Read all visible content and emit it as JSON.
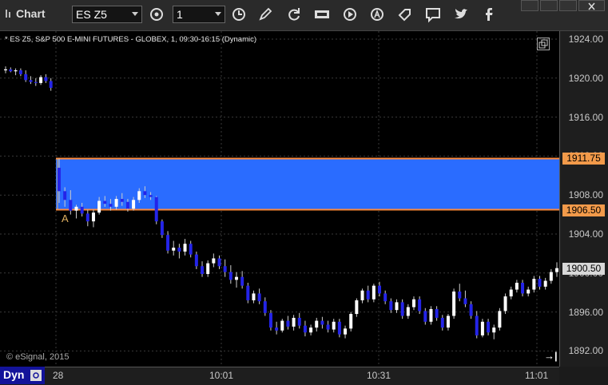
{
  "app": {
    "title": "Chart"
  },
  "toolbar": {
    "symbol": "ES Z5",
    "interval": "1",
    "buttons": [
      "settings-icon",
      "clock-icon",
      "pencil-icon",
      "refresh-icon",
      "get-icon",
      "play-icon",
      "alert-icon",
      "tag-icon",
      "comment-icon",
      "twitter-icon",
      "facebook-icon"
    ]
  },
  "chart": {
    "info_line": "* ES Z5, S&P 500 E-MINI FUTURES - GLOBEX, 1, 09:30-16:15 (Dynamic)",
    "copyright": "© eSignal, 2015",
    "annotation_label": "A",
    "price_ticks": [
      "1924.00",
      "1920.00",
      "1916.00",
      "1912.00",
      "1908.00",
      "1904.00",
      "1900.00",
      "1896.00",
      "1892.00"
    ],
    "price_tags": {
      "upper": "1911.75",
      "lower": "1906.50",
      "last": "1900.50"
    },
    "zone_color": "#2a6cff",
    "line_color": "#ff8a3a",
    "time_labels": [
      "28",
      "10:01",
      "10:31",
      "11:01"
    ],
    "mode_label": "Dyn"
  },
  "chart_data": {
    "type": "candlestick",
    "ylim": [
      1891.5,
      1925.5
    ],
    "zone": {
      "top": 1911.75,
      "bottom": 1906.5
    },
    "last": 1900.5,
    "candles": [
      [
        1920.8,
        1921.2,
        1920.5,
        1920.9
      ],
      [
        1920.9,
        1921.1,
        1920.6,
        1920.7
      ],
      [
        1920.7,
        1921.0,
        1920.3,
        1920.8
      ],
      [
        1920.8,
        1921.0,
        1920.2,
        1920.4
      ],
      [
        1920.4,
        1920.8,
        1919.6,
        1919.8
      ],
      [
        1919.8,
        1920.2,
        1919.4,
        1919.6
      ],
      [
        1919.6,
        1920.0,
        1919.2,
        1919.5
      ],
      [
        1919.5,
        1920.3,
        1919.3,
        1920.1
      ],
      [
        1920.1,
        1920.4,
        1919.5,
        1919.7
      ],
      [
        1919.7,
        1920.0,
        1918.7,
        1919.0
      ],
      [
        1910.8,
        1911.75,
        1907.2,
        1908.4
      ],
      [
        1908.4,
        1908.8,
        1906.8,
        1907.5
      ],
      [
        1907.5,
        1908.5,
        1906.0,
        1906.4
      ],
      [
        1906.4,
        1907.0,
        1905.6,
        1906.8
      ],
      [
        1906.8,
        1907.2,
        1905.8,
        1906.1
      ],
      [
        1906.1,
        1906.5,
        1904.8,
        1905.3
      ],
      [
        1905.3,
        1906.5,
        1904.7,
        1906.2
      ],
      [
        1906.2,
        1907.8,
        1906.0,
        1907.4
      ],
      [
        1907.4,
        1907.9,
        1906.8,
        1907.1
      ],
      [
        1907.1,
        1907.6,
        1906.4,
        1906.8
      ],
      [
        1906.8,
        1907.9,
        1906.5,
        1907.6
      ],
      [
        1907.6,
        1908.2,
        1906.9,
        1907.3
      ],
      [
        1907.3,
        1907.6,
        1906.3,
        1906.6
      ],
      [
        1906.6,
        1907.8,
        1906.4,
        1907.5
      ],
      [
        1907.5,
        1908.7,
        1907.2,
        1908.4
      ],
      [
        1908.4,
        1908.9,
        1907.7,
        1908.0
      ],
      [
        1908.0,
        1908.3,
        1907.5,
        1907.8
      ],
      [
        1907.8,
        1907.9,
        1905.0,
        1905.3
      ],
      [
        1905.3,
        1905.5,
        1903.6,
        1903.9
      ],
      [
        1903.9,
        1904.3,
        1902.0,
        1902.3
      ],
      [
        1902.3,
        1903.3,
        1901.8,
        1902.6
      ],
      [
        1902.6,
        1903.0,
        1901.5,
        1902.2
      ],
      [
        1902.2,
        1903.5,
        1901.8,
        1903.0
      ],
      [
        1903.0,
        1903.3,
        1901.6,
        1901.9
      ],
      [
        1901.9,
        1902.2,
        1900.4,
        1900.7
      ],
      [
        1900.7,
        1901.2,
        1899.6,
        1899.9
      ],
      [
        1899.9,
        1901.3,
        1899.6,
        1901.0
      ],
      [
        1901.0,
        1902.0,
        1900.6,
        1901.5
      ],
      [
        1901.5,
        1901.8,
        1900.4,
        1900.7
      ],
      [
        1900.7,
        1901.4,
        1899.6,
        1900.1
      ],
      [
        1900.1,
        1900.8,
        1898.9,
        1899.3
      ],
      [
        1899.3,
        1900.1,
        1898.5,
        1899.6
      ],
      [
        1899.6,
        1900.2,
        1898.4,
        1898.7
      ],
      [
        1898.7,
        1899.0,
        1896.9,
        1897.2
      ],
      [
        1897.2,
        1898.2,
        1896.9,
        1897.9
      ],
      [
        1897.9,
        1898.4,
        1896.8,
        1897.1
      ],
      [
        1897.1,
        1897.5,
        1895.6,
        1895.9
      ],
      [
        1895.9,
        1896.2,
        1894.1,
        1894.4
      ],
      [
        1894.4,
        1895.0,
        1893.7,
        1894.1
      ],
      [
        1894.1,
        1895.3,
        1893.9,
        1895.1
      ],
      [
        1895.1,
        1895.6,
        1894.2,
        1894.5
      ],
      [
        1894.5,
        1895.7,
        1894.1,
        1895.4
      ],
      [
        1895.4,
        1895.9,
        1894.3,
        1894.6
      ],
      [
        1894.6,
        1895.1,
        1893.5,
        1893.9
      ],
      [
        1893.9,
        1894.7,
        1893.6,
        1894.4
      ],
      [
        1894.4,
        1895.4,
        1894.0,
        1895.1
      ],
      [
        1895.1,
        1895.5,
        1894.3,
        1894.7
      ],
      [
        1894.7,
        1895.1,
        1893.9,
        1894.2
      ],
      [
        1894.2,
        1895.3,
        1893.9,
        1895.0
      ],
      [
        1895.0,
        1895.3,
        1893.4,
        1893.7
      ],
      [
        1893.7,
        1894.6,
        1893.3,
        1894.3
      ],
      [
        1894.3,
        1896.0,
        1894.0,
        1895.8
      ],
      [
        1895.8,
        1897.4,
        1895.5,
        1897.2
      ],
      [
        1897.2,
        1898.4,
        1896.9,
        1898.2
      ],
      [
        1898.2,
        1898.7,
        1897.0,
        1897.3
      ],
      [
        1897.3,
        1898.9,
        1897.0,
        1898.7
      ],
      [
        1898.7,
        1899.1,
        1897.6,
        1897.9
      ],
      [
        1897.9,
        1898.2,
        1896.8,
        1897.1
      ],
      [
        1897.1,
        1897.4,
        1895.9,
        1896.2
      ],
      [
        1896.2,
        1897.3,
        1895.9,
        1897.0
      ],
      [
        1897.0,
        1897.3,
        1895.3,
        1895.6
      ],
      [
        1895.6,
        1896.8,
        1895.3,
        1896.5
      ],
      [
        1896.5,
        1897.6,
        1896.2,
        1897.3
      ],
      [
        1897.3,
        1897.6,
        1895.8,
        1896.1
      ],
      [
        1896.1,
        1896.4,
        1894.7,
        1895.0
      ],
      [
        1895.0,
        1896.6,
        1894.7,
        1896.3
      ],
      [
        1896.3,
        1896.6,
        1895.1,
        1895.4
      ],
      [
        1895.4,
        1895.7,
        1894.1,
        1894.4
      ],
      [
        1894.4,
        1895.8,
        1894.1,
        1895.6
      ],
      [
        1895.6,
        1898.4,
        1895.3,
        1898.1
      ],
      [
        1898.1,
        1898.9,
        1897.1,
        1897.4
      ],
      [
        1897.4,
        1898.2,
        1896.5,
        1896.8
      ],
      [
        1896.8,
        1897.1,
        1895.3,
        1895.6
      ],
      [
        1895.6,
        1896.1,
        1893.3,
        1893.6
      ],
      [
        1893.6,
        1895.3,
        1893.4,
        1895.0
      ],
      [
        1895.0,
        1895.3,
        1893.6,
        1893.9
      ],
      [
        1893.9,
        1894.7,
        1893.2,
        1894.4
      ],
      [
        1894.4,
        1896.4,
        1894.1,
        1896.1
      ],
      [
        1896.1,
        1897.9,
        1895.8,
        1897.6
      ],
      [
        1897.6,
        1898.6,
        1897.3,
        1898.3
      ],
      [
        1898.3,
        1899.3,
        1898.0,
        1899.0
      ],
      [
        1899.0,
        1899.3,
        1897.6,
        1897.9
      ],
      [
        1897.9,
        1898.6,
        1897.6,
        1898.3
      ],
      [
        1898.3,
        1899.7,
        1898.0,
        1899.4
      ],
      [
        1899.4,
        1899.7,
        1898.3,
        1898.6
      ],
      [
        1898.6,
        1899.5,
        1898.3,
        1899.2
      ],
      [
        1899.2,
        1900.4,
        1898.9,
        1900.1
      ],
      [
        1900.1,
        1901.1,
        1899.6,
        1900.5
      ]
    ]
  }
}
